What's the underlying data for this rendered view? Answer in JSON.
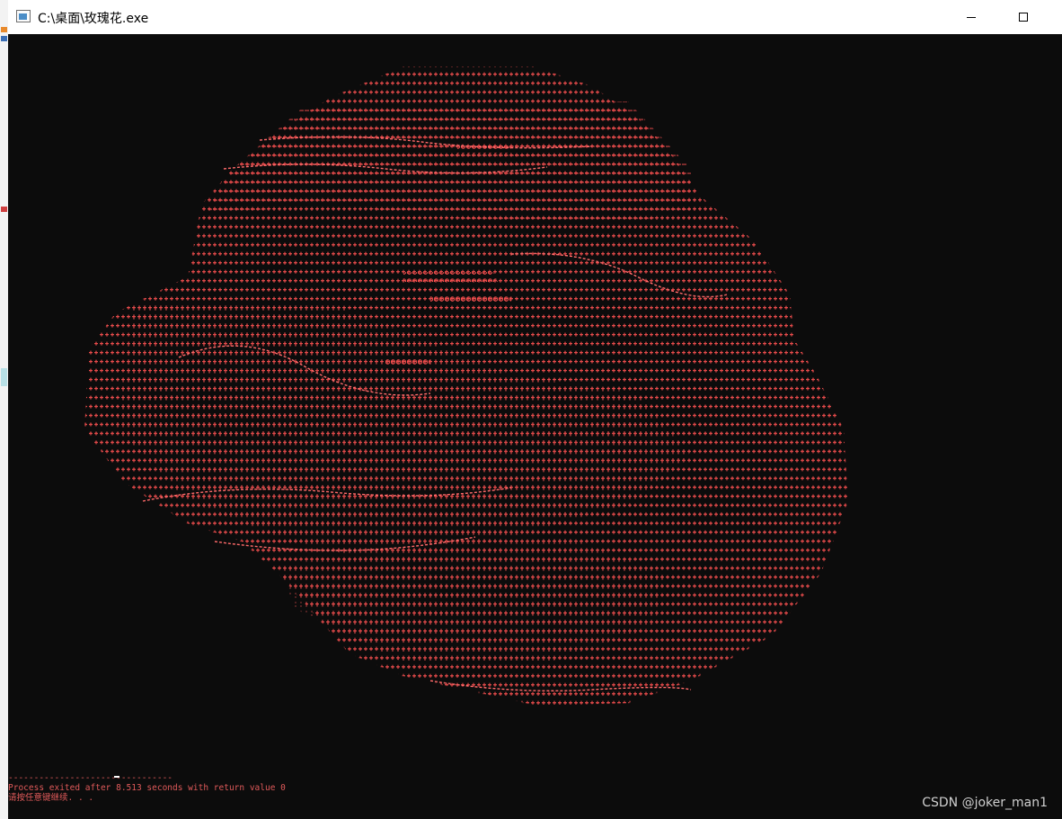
{
  "window": {
    "title": "C:\\桌面\\玫瑰花.exe",
    "minimize_glyph": "minimize",
    "maximize_glyph": "maximize"
  },
  "console": {
    "separator": "--------------------------------",
    "exit_message": "Process exited after 8.513 seconds with return value 0",
    "prompt": "请按任意键继续. . .",
    "text_color": "#e05a5a",
    "background": "#0c0c0c",
    "art_glyphs": "+-*=#@:.,",
    "art_description_color": "#e84b4b"
  },
  "watermark": "CSDN @joker_man1"
}
